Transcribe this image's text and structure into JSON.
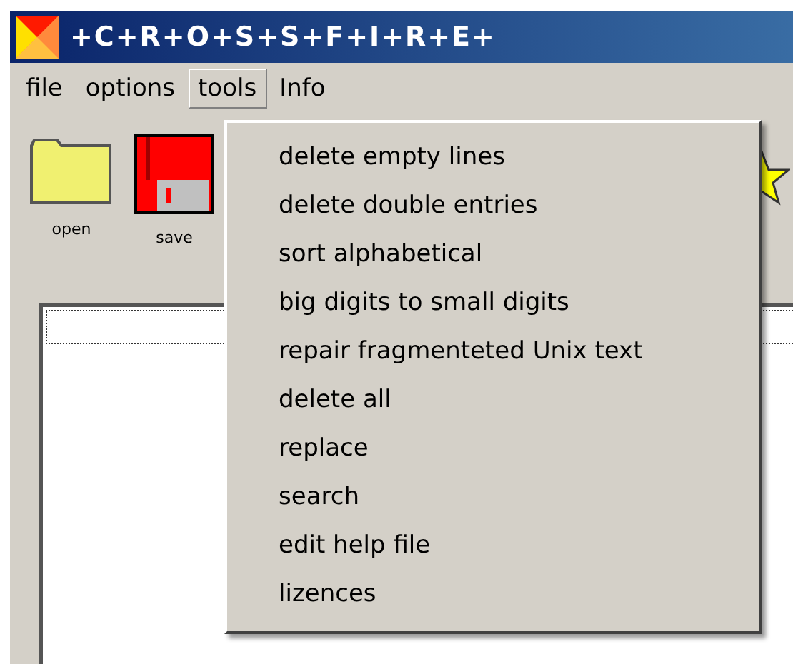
{
  "window": {
    "title": "+C+R+O+S+S+F+I+R+E+"
  },
  "menu_bar": [
    {
      "label": "file",
      "selected": false
    },
    {
      "label": "options",
      "selected": false
    },
    {
      "label": "tools",
      "selected": true
    },
    {
      "label": "Info",
      "selected": false
    }
  ],
  "toolbar": [
    {
      "label": "open",
      "kind": "folder"
    },
    {
      "label": "save",
      "kind": "disk"
    }
  ],
  "dropdown": [
    "delete empty lines",
    "delete double entries",
    "sort alphabetical",
    "big digits to small digits",
    "repair fragmenteted Unix text",
    "delete all",
    "replace",
    "search",
    "edit help file",
    "lizences"
  ]
}
